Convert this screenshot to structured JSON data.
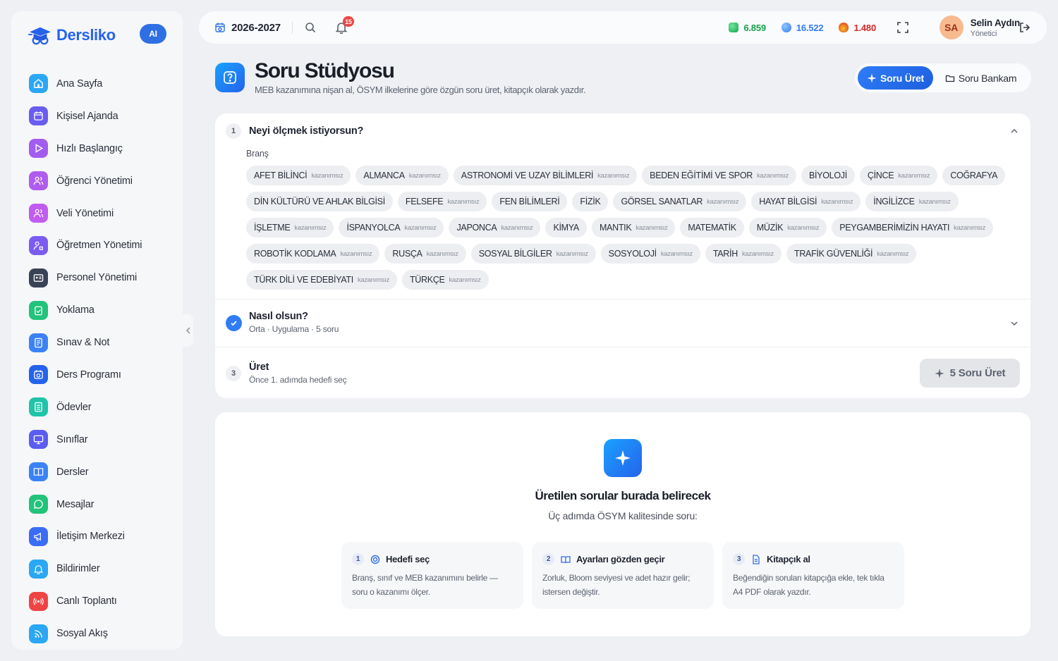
{
  "brand": {
    "name": "Dersliko",
    "ai_badge": "AI"
  },
  "sidebar": {
    "items": [
      {
        "label": "Ana Sayfa",
        "icon": "home-icon",
        "color": "#2aa7f5"
      },
      {
        "label": "Kişisel Ajanda",
        "icon": "calendar-icon",
        "color": "#6b5cf0"
      },
      {
        "label": "Hızlı Başlangıç",
        "icon": "play-icon",
        "color": "#a35cf0"
      },
      {
        "label": "Öğrenci Yönetimi",
        "icon": "users-icon",
        "color": "#b05cf0"
      },
      {
        "label": "Veli Yönetimi",
        "icon": "users-icon",
        "color": "#c15cf0"
      },
      {
        "label": "Öğretmen Yönetimi",
        "icon": "teacher-icon",
        "color": "#7b5cf0"
      },
      {
        "label": "Personel Yönetimi",
        "icon": "id-card-icon",
        "color": "#3a4256"
      },
      {
        "label": "Yoklama",
        "icon": "clipboard-check-icon",
        "color": "#22c37a"
      },
      {
        "label": "Sınav & Not",
        "icon": "exam-icon",
        "color": "#3b82f6"
      },
      {
        "label": "Ders Programı",
        "icon": "schedule-icon",
        "color": "#2563eb"
      },
      {
        "label": "Ödevler",
        "icon": "homework-icon",
        "color": "#20c4a8"
      },
      {
        "label": "Sınıflar",
        "icon": "monitor-icon",
        "color": "#5b5cf0"
      },
      {
        "label": "Dersler",
        "icon": "book-icon",
        "color": "#3b82f6"
      },
      {
        "label": "Mesajlar",
        "icon": "message-icon",
        "color": "#22c37a"
      },
      {
        "label": "İletişim Merkezi",
        "icon": "megaphone-icon",
        "color": "#3b6cf6"
      },
      {
        "label": "Bildirimler",
        "icon": "bell-icon",
        "color": "#2aa7f5"
      },
      {
        "label": "Canlı Toplantı",
        "icon": "broadcast-icon",
        "color": "#ef4444"
      },
      {
        "label": "Sosyal Akış",
        "icon": "rss-icon",
        "color": "#2aa7f5"
      }
    ]
  },
  "topbar": {
    "year": "2026-2027",
    "notification_count": "15",
    "stats": [
      {
        "value": "6.859",
        "icon": "gem-green-icon",
        "color": "#16a34a"
      },
      {
        "value": "16.522",
        "icon": "gem-blue-icon",
        "color": "#2f7cf6"
      },
      {
        "value": "1.480",
        "icon": "fire-icon",
        "color": "#dc2626"
      }
    ],
    "user": {
      "initials": "SA",
      "name": "Selin Aydın",
      "role": "Yönetici"
    }
  },
  "header": {
    "title": "Soru Stüdyosu",
    "subtitle": "MEB kazanımına nişan al, ÖSYM ilkelerine göre özgün soru üret, kitapçık olarak yazdır.",
    "mode_active": "Soru Üret",
    "mode_inactive": "Soru Bankam"
  },
  "steps": {
    "step1": {
      "num": "1",
      "title": "Neyi ölçmek istiyorsun?",
      "brans_label": "Branş"
    },
    "step2": {
      "title": "Nasıl olsun?",
      "sub": "Orta · Uygulama · 5 soru"
    },
    "step3": {
      "num": "3",
      "title": "Üret",
      "sub": "Önce 1. adımda hedefi seç",
      "button": "5 Soru Üret"
    }
  },
  "subjects": [
    {
      "name": "AFET BİLİNCİ",
      "tag": "kazanımsız"
    },
    {
      "name": "ALMANCA",
      "tag": "kazanımsız"
    },
    {
      "name": "ASTRONOMİ VE UZAY BİLİMLERİ",
      "tag": "kazanımsız"
    },
    {
      "name": "BEDEN EĞİTİMİ VE SPOR",
      "tag": "kazanımsız"
    },
    {
      "name": "BİYOLOJİ",
      "tag": ""
    },
    {
      "name": "ÇİNCE",
      "tag": "kazanımsız"
    },
    {
      "name": "COĞRAFYA",
      "tag": ""
    },
    {
      "name": "DİN KÜLTÜRÜ VE AHLAK BİLGİSİ",
      "tag": ""
    },
    {
      "name": "FELSEFE",
      "tag": "kazanımsız"
    },
    {
      "name": "FEN BİLİMLERİ",
      "tag": ""
    },
    {
      "name": "FİZİK",
      "tag": ""
    },
    {
      "name": "GÖRSEL SANATLAR",
      "tag": "kazanımsız"
    },
    {
      "name": "HAYAT BİLGİSİ",
      "tag": "kazanımsız"
    },
    {
      "name": "İNGİLİZCE",
      "tag": "kazanımsız"
    },
    {
      "name": "İŞLETME",
      "tag": "kazanımsız"
    },
    {
      "name": "İSPANYOLCA",
      "tag": "kazanımsız"
    },
    {
      "name": "JAPONCA",
      "tag": "kazanımsız"
    },
    {
      "name": "KİMYA",
      "tag": ""
    },
    {
      "name": "MANTIK",
      "tag": "kazanımsız"
    },
    {
      "name": "MATEMATİK",
      "tag": ""
    },
    {
      "name": "MÜZİK",
      "tag": "kazanımsız"
    },
    {
      "name": "PEYGAMBERİMİZİN HAYATI",
      "tag": "kazanımsız"
    },
    {
      "name": "ROBOTİK KODLAMA",
      "tag": "kazanımsız"
    },
    {
      "name": "RUSÇA",
      "tag": "kazanımsız"
    },
    {
      "name": "SOSYAL BİLGİLER",
      "tag": "kazanımsız"
    },
    {
      "name": "SOSYOLOJİ",
      "tag": "kazanımsız"
    },
    {
      "name": "TARİH",
      "tag": "kazanımsız"
    },
    {
      "name": "TRAFİK GÜVENLİĞİ",
      "tag": "kazanımsız"
    },
    {
      "name": "TÜRK DİLİ VE EDEBİYATI",
      "tag": "kazanımsız"
    },
    {
      "name": "TÜRKÇE",
      "tag": "kazanımsız"
    }
  ],
  "empty": {
    "title": "Üretilen sorular burada belirecek",
    "subtitle": "Üç adımda ÖSYM kalitesinde soru:",
    "hints": [
      {
        "num": "1",
        "title": "Hedefi seç",
        "text": "Branş, sınıf ve MEB kazanımını belirle — soru o kazanımı ölçer.",
        "icon": "target-icon"
      },
      {
        "num": "2",
        "title": "Ayarları gözden geçir",
        "text": "Zorluk, Bloom seviyesi ve adet hazır gelir; istersen değiştir.",
        "icon": "book-open-icon"
      },
      {
        "num": "3",
        "title": "Kitapçık al",
        "text": "Beğendiğin soruları kitapçığa ekle, tek tıkla A4 PDF olarak yazdır.",
        "icon": "document-icon"
      }
    ]
  }
}
